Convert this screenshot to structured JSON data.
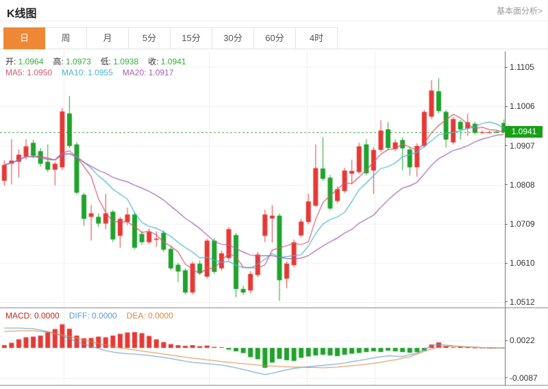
{
  "header": {
    "title": "K线图",
    "more_link": "基本面分析>"
  },
  "tabs": {
    "items": [
      "日",
      "周",
      "月",
      "5分",
      "15分",
      "30分",
      "60分",
      "4时"
    ],
    "selected": "日"
  },
  "quote_legend": {
    "items": [
      {
        "label": "开:",
        "value": "1.0964"
      },
      {
        "label": "高:",
        "value": "1.0973"
      },
      {
        "label": "低:",
        "value": "1.0938"
      },
      {
        "label": "收:",
        "value": "1.0941"
      }
    ],
    "label_color": "#333333",
    "value_color": "#2eb135"
  },
  "ma_legend": {
    "items": [
      {
        "label": "MA5:",
        "value": "1.0950",
        "color": "#d9566e"
      },
      {
        "label": "MA10:",
        "value": "1.0955",
        "color": "#4ab4d6"
      },
      {
        "label": "MA20:",
        "value": "1.0917",
        "color": "#a55cb8"
      }
    ]
  },
  "macd_legend": {
    "items": [
      {
        "label": "MACD:",
        "value": "0.0000",
        "color": "#c3291c"
      },
      {
        "label": "DIFF:",
        "value": "0.0000",
        "color": "#5b9bd5"
      },
      {
        "label": "DEA:",
        "value": "0.0000",
        "color": "#e2883a"
      }
    ]
  },
  "price_axis": {
    "ticks": [
      "1.1105",
      "1.1006",
      "1.0907",
      "1.0808",
      "1.0709",
      "1.0610",
      "1.0512"
    ],
    "last_price_badge": "1.0941"
  },
  "macd_axis": {
    "ticks": [
      "0.0022",
      "-0.0087"
    ]
  },
  "colors": {
    "up": "#e53935",
    "down": "#1fa32c",
    "ma5": "#d9566e",
    "ma10": "#4ab4d6",
    "ma20": "#a55cb8",
    "diff": "#5b9bd5",
    "dea": "#e2883a",
    "last_price_line": "#2fa52f",
    "badge_bg": "#18a018",
    "grid": "#f0f0f0",
    "vgrid": "#ececec",
    "tab_active_bg": "#ef8836"
  },
  "chart_data": {
    "type": "candlestick+macd",
    "title": "K线图 (Daily K-line with MA5/MA10/MA20 overlays and MACD panel)",
    "last_price": 1.0941,
    "panels": [
      {
        "type": "candlestick",
        "ylim": [
          1.0495,
          1.1125
        ],
        "y_ticks": [
          1.1105,
          1.1006,
          1.0907,
          1.0808,
          1.0709,
          1.061,
          1.0512
        ],
        "overlays": [
          "MA5",
          "MA10",
          "MA20"
        ],
        "candle_format": [
          "open",
          "high",
          "low",
          "close"
        ],
        "candles": [
          [
            1.0818,
            1.087,
            1.0806,
            1.0858
          ],
          [
            1.0861,
            1.0923,
            1.0809,
            1.0869
          ],
          [
            1.0866,
            1.0897,
            1.0826,
            1.0884
          ],
          [
            1.0879,
            1.0923,
            1.0872,
            1.0905
          ],
          [
            1.0914,
            1.0922,
            1.0875,
            1.0881
          ],
          [
            1.0893,
            1.0901,
            1.0854,
            1.0861
          ],
          [
            1.0866,
            1.091,
            1.084,
            1.0846
          ],
          [
            1.0846,
            1.0866,
            1.0806,
            1.0861
          ],
          [
            1.0852,
            1.1002,
            1.0845,
            1.0993
          ],
          [
            1.0988,
            1.1032,
            1.0901,
            1.0906
          ],
          [
            1.091,
            1.0915,
            1.0783,
            1.0788
          ],
          [
            1.0783,
            1.0788,
            1.0705,
            1.0722
          ],
          [
            1.0727,
            1.0757,
            1.0667,
            1.0736
          ],
          [
            1.0727,
            1.0736,
            1.0701,
            1.071
          ],
          [
            1.071,
            1.0785,
            1.0696,
            1.0736
          ],
          [
            1.074,
            1.0744,
            1.0663,
            1.067
          ],
          [
            1.0679,
            1.0727,
            1.0649,
            1.0722
          ],
          [
            1.0714,
            1.075,
            1.0706,
            1.0733
          ],
          [
            1.0733,
            1.074,
            1.0645,
            1.0649
          ],
          [
            1.0684,
            1.0691,
            1.0656,
            1.0663
          ],
          [
            1.0663,
            1.0698,
            1.0658,
            1.0689
          ],
          [
            1.0669,
            1.0691,
            1.0651,
            1.0672
          ],
          [
            1.0687,
            1.0693,
            1.0638,
            1.0644
          ],
          [
            1.0646,
            1.0653,
            1.0592,
            1.0597
          ],
          [
            1.0606,
            1.0611,
            1.0562,
            1.0589
          ],
          [
            1.0592,
            1.0597,
            1.0531,
            1.0536
          ],
          [
            1.0536,
            1.0614,
            1.0531,
            1.0609
          ],
          [
            1.0609,
            1.0617,
            1.058,
            1.0585
          ],
          [
            1.0576,
            1.0672,
            1.0571,
            1.0667
          ],
          [
            1.0667,
            1.0674,
            1.0583,
            1.0588
          ],
          [
            1.0597,
            1.0642,
            1.0592,
            1.0635
          ],
          [
            1.0623,
            1.0701,
            1.0617,
            1.0696
          ],
          [
            1.0681,
            1.0687,
            1.0524,
            1.0545
          ],
          [
            1.0545,
            1.0553,
            1.053,
            1.0536
          ],
          [
            1.0541,
            1.059,
            1.0535,
            1.0583
          ],
          [
            1.058,
            1.0638,
            1.0575,
            1.0632
          ],
          [
            1.0679,
            1.0745,
            1.0663,
            1.0733
          ],
          [
            1.0723,
            1.0757,
            1.0662,
            1.073
          ],
          [
            1.073,
            1.0736,
            1.0515,
            1.0567
          ],
          [
            1.0571,
            1.0614,
            1.0547,
            1.0609
          ],
          [
            1.0605,
            1.067,
            1.06,
            1.0663
          ],
          [
            1.068,
            1.0722,
            1.0675,
            1.0715
          ],
          [
            1.0714,
            1.0785,
            1.0708,
            1.0766
          ],
          [
            1.0755,
            1.091,
            1.0752,
            1.085
          ],
          [
            1.0849,
            1.0928,
            1.0818,
            1.0823
          ],
          [
            1.0826,
            1.0833,
            1.0743,
            1.0748
          ],
          [
            1.0767,
            1.0804,
            1.0762,
            1.0797
          ],
          [
            1.0792,
            1.0851,
            1.0787,
            1.0844
          ],
          [
            1.0836,
            1.0871,
            1.081,
            1.0843
          ],
          [
            1.084,
            1.0914,
            1.0835,
            1.0905
          ],
          [
            1.091,
            1.0923,
            1.0831,
            1.0837
          ],
          [
            1.0844,
            1.0903,
            1.0785,
            1.0896
          ],
          [
            1.0896,
            1.0971,
            1.0891,
            1.0945
          ],
          [
            1.0948,
            1.0966,
            1.0896,
            1.0901
          ],
          [
            1.0898,
            1.0922,
            1.0893,
            1.0915
          ],
          [
            1.0921,
            1.0928,
            1.0844,
            1.09
          ],
          [
            1.0897,
            1.0904,
            1.0831,
            1.0852
          ],
          [
            1.0852,
            1.0913,
            1.0828,
            1.0906
          ],
          [
            1.0906,
            1.0997,
            1.0901,
            1.0992
          ],
          [
            1.098,
            1.1072,
            1.0974,
            1.1046
          ],
          [
            1.1044,
            1.1077,
            1.0988,
            1.0994
          ],
          [
            1.0992,
            1.0997,
            1.0902,
            1.0922
          ],
          [
            1.0915,
            1.098,
            1.091,
            1.0974
          ],
          [
            1.0967,
            1.0972,
            1.0922,
            1.0948
          ],
          [
            1.095,
            1.0988,
            1.0931,
            1.0966
          ],
          [
            1.0962,
            1.0967,
            1.0934,
            1.0939
          ],
          [
            1.0941,
            1.0945,
            1.0937,
            1.0941
          ],
          [
            1.0941,
            1.0944,
            1.0938,
            1.0941
          ],
          [
            1.0942,
            1.0945,
            1.0938,
            1.0941
          ],
          [
            1.0964,
            1.0973,
            1.0938,
            1.0941
          ]
        ]
      },
      {
        "type": "macd",
        "ylim": [
          -0.0105,
          0.009
        ],
        "y_ticks": [
          0.0022,
          -0.0087
        ],
        "hist": [
          0.0008,
          0.0015,
          0.0025,
          0.0031,
          0.0033,
          0.0036,
          0.0046,
          0.0055,
          0.0069,
          0.0056,
          0.0036,
          0.0028,
          0.0029,
          0.0033,
          0.0031,
          0.0036,
          0.0041,
          0.0045,
          0.0046,
          0.0043,
          0.0035,
          0.0025,
          0.0017,
          0.0011,
          0.0008,
          0.0006,
          0.0008,
          0.0005,
          0.0007,
          0.0003,
          0.0002,
          -0.0005,
          -0.001,
          -0.0015,
          -0.0027,
          -0.0033,
          -0.0058,
          -0.0043,
          -0.0032,
          -0.0036,
          -0.0038,
          -0.0029,
          -0.0025,
          -0.0022,
          -0.002,
          -0.0022,
          -0.0024,
          -0.002,
          -0.0017,
          -0.0015,
          -0.0012,
          -0.001,
          -0.0012,
          -0.0008,
          -0.001,
          -0.0012,
          -0.0014,
          -0.0012,
          -0.0008,
          0.001,
          0.0016,
          0.0006,
          0.0002,
          0.0004,
          0.0002,
          0.0001,
          0.0001,
          0.0,
          0.0,
          0.0
        ],
        "diff": [
          0.0058,
          0.0058,
          0.0058,
          0.0057,
          0.0056,
          0.0052,
          0.0048,
          0.0042,
          0.0035,
          0.0027,
          0.0018,
          0.0011,
          0.0005,
          -0.0002,
          -0.0008,
          -0.0012,
          -0.0015,
          -0.0017,
          -0.0018,
          -0.002,
          -0.0022,
          -0.0025,
          -0.0028,
          -0.0031,
          -0.0035,
          -0.0039,
          -0.0042,
          -0.0044,
          -0.0046,
          -0.0048,
          -0.005,
          -0.0054,
          -0.0058,
          -0.0063,
          -0.0068,
          -0.0073,
          -0.0078,
          -0.0074,
          -0.0069,
          -0.0064,
          -0.006,
          -0.0057,
          -0.0055,
          -0.0053,
          -0.0051,
          -0.0049,
          -0.0047,
          -0.0044,
          -0.004,
          -0.0037,
          -0.0033,
          -0.0029,
          -0.0026,
          -0.0023,
          -0.0024,
          -0.0025,
          -0.002,
          -0.0015,
          -0.0006,
          0.0007,
          0.001,
          0.0008,
          0.0006,
          0.0004,
          0.0003,
          0.0002,
          0.0001,
          0.0001,
          0.0,
          0.0
        ],
        "dea": [
          0.0048,
          0.0049,
          0.005,
          0.005,
          0.005,
          0.0048,
          0.0046,
          0.0042,
          0.0038,
          0.0033,
          0.0028,
          0.0023,
          0.0018,
          0.0013,
          0.0008,
          0.0004,
          0.0,
          -0.0003,
          -0.0006,
          -0.0009,
          -0.0012,
          -0.0015,
          -0.0018,
          -0.0021,
          -0.0024,
          -0.0027,
          -0.003,
          -0.0032,
          -0.0035,
          -0.0037,
          -0.004,
          -0.0042,
          -0.0044,
          -0.0046,
          -0.0048,
          -0.005,
          -0.0052,
          -0.0053,
          -0.0054,
          -0.0055,
          -0.0056,
          -0.0056,
          -0.0057,
          -0.0057,
          -0.0058,
          -0.0057,
          -0.0056,
          -0.0054,
          -0.0052,
          -0.005,
          -0.0048,
          -0.0045,
          -0.0042,
          -0.0038,
          -0.0035,
          -0.003,
          -0.0026,
          -0.0018,
          -0.001,
          -0.0003,
          0.0002,
          0.0005,
          0.0005,
          0.0004,
          0.0003,
          0.0002,
          0.0001,
          0.0001,
          0.0,
          0.0
        ]
      }
    ]
  }
}
